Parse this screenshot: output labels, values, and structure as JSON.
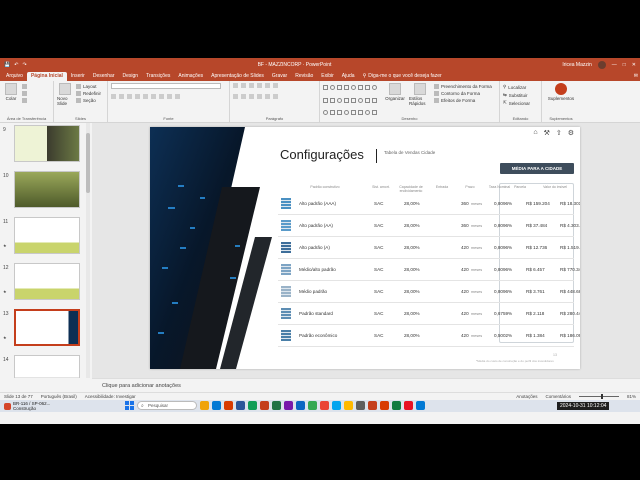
{
  "window": {
    "title": "BF - MAZZINCORP · PowerPoint",
    "user": "Iricea Mazzin",
    "qa_icons": [
      "save-icon",
      "undo-icon",
      "redo-icon"
    ]
  },
  "tabs": [
    {
      "label": "Arquivo",
      "active": false
    },
    {
      "label": "Página Inicial",
      "active": true
    },
    {
      "label": "Inserir",
      "active": false
    },
    {
      "label": "Desenhar",
      "active": false
    },
    {
      "label": "Design",
      "active": false
    },
    {
      "label": "Transições",
      "active": false
    },
    {
      "label": "Animações",
      "active": false
    },
    {
      "label": "Apresentação de Slides",
      "active": false
    },
    {
      "label": "Gravar",
      "active": false
    },
    {
      "label": "Revisão",
      "active": false
    },
    {
      "label": "Exibir",
      "active": false
    },
    {
      "label": "Ajuda",
      "active": false
    }
  ],
  "tell_me": "Diga-me o que você deseja fazer",
  "ribbon": {
    "clipboard": {
      "paste": "Colar",
      "label": "Área de Transferência"
    },
    "slides": {
      "new_slide": "Novo Slide",
      "layout": "Layout",
      "reset": "Redefinir",
      "section": "Seção",
      "label": "Slides"
    },
    "font": {
      "label": "Fonte"
    },
    "paragraph": {
      "label": "Parágrafo"
    },
    "drawing": {
      "arrange": "Organizar",
      "quick_styles": "Estilos Rápidos",
      "fill": "Preenchimento da Forma",
      "outline": "Contorno da Forma",
      "effects": "Efeitos de Forma",
      "label": "Desenho"
    },
    "editing": {
      "find": "Localizar",
      "replace": "Substituir",
      "select": "Selecionar",
      "label": "Editando"
    },
    "addins": {
      "button": "Suplementos",
      "label": "Suplementos"
    }
  },
  "thumbnails": [
    {
      "num": "9",
      "star": ""
    },
    {
      "num": "10",
      "star": ""
    },
    {
      "num": "11",
      "star": "★"
    },
    {
      "num": "12",
      "star": "★"
    },
    {
      "num": "13",
      "star": "★"
    },
    {
      "num": "14",
      "star": ""
    }
  ],
  "slide": {
    "title": "Configurações",
    "subtitle": "Tabela de Vendas Cidade",
    "city_header": "MÉDIA PARA A CIDADE",
    "columns": [
      "Padrão construtivo",
      "Sist. amort.",
      "Capacidade de endividamento",
      "Entrada",
      "Prazo",
      "Taxa Nominal",
      "Parcela",
      "Valor do imóvel"
    ],
    "rows": [
      {
        "name": "Alto padrão (AAA)",
        "system": "SAC",
        "capacity": "28,00%",
        "term": "360",
        "term_unit": "meses",
        "rate": "0,8096%",
        "installment": "R$ 159.204",
        "value": "R$ 18.301.399"
      },
      {
        "name": "Alto padrão (AA)",
        "system": "SAC",
        "capacity": "28,00%",
        "term": "360",
        "term_unit": "meses",
        "rate": "0,8096%",
        "installment": "R$ 37.484",
        "value": "R$ 4.303.245"
      },
      {
        "name": "Alto padrão (A)",
        "system": "SAC",
        "capacity": "28,00%",
        "term": "420",
        "term_unit": "meses",
        "rate": "0,8096%",
        "installment": "R$ 12.736",
        "value": "R$ 1.519.929"
      },
      {
        "name": "Médio/alto padrão",
        "system": "SAC",
        "capacity": "28,00%",
        "term": "420",
        "term_unit": "meses",
        "rate": "0,8096%",
        "installment": "R$ 6.457",
        "value": "R$ 770.342"
      },
      {
        "name": "Médio padrão",
        "system": "SAC",
        "capacity": "28,00%",
        "term": "420",
        "term_unit": "meses",
        "rate": "0,8096%",
        "installment": "R$ 3.761",
        "value": "R$ 448.683"
      },
      {
        "name": "Padrão standard",
        "system": "SAC",
        "capacity": "28,00%",
        "term": "420",
        "term_unit": "meses",
        "rate": "0,6759%",
        "installment": "R$ 2.118",
        "value": "R$ 280.445"
      },
      {
        "name": "Padrão econômico",
        "system": "SAC",
        "capacity": "28,00%",
        "term": "420",
        "term_unit": "meses",
        "rate": "0,5002%",
        "installment": "R$ 1.384",
        "value": "R$ 186.099"
      }
    ],
    "slide_number": "13",
    "footnote": "*Média do custo de construção e do perfil dos investidores",
    "toolicons": [
      "home-icon",
      "wrench-icon",
      "share-icon",
      "settings-icon"
    ]
  },
  "notes_placeholder": "Clique para adicionar anotações",
  "status": {
    "slide_of": "Slide 13 de 77",
    "language": "Português (Brasil)",
    "accessibility": "Acessibilidade: Investigar",
    "notes": "Anotações",
    "comments": "Comentários",
    "zoom": "81%"
  },
  "taskbar": {
    "weather_temp": "BR-116 / SP-062...",
    "weather_note": "Construção",
    "search": "Pesquisar",
    "datetime": "2024-10-31  10:12:04",
    "apps": [
      "#f0a30a",
      "#0078d4",
      "#d83b01",
      "#2b579a",
      "#0f9d58",
      "#c43e1c",
      "#217346",
      "#7719aa",
      "#0a66c2",
      "#34a853",
      "#ea4335",
      "#00a4ef",
      "#ffb900",
      "#5e5e5e",
      "#c43e1c",
      "#d83b01",
      "#107c41",
      "#e81123",
      "#0078d4"
    ]
  },
  "colors": {
    "accent": "#b7472a",
    "header_box": "#3e4d5c",
    "selected_thumb": "#c43e1c"
  }
}
